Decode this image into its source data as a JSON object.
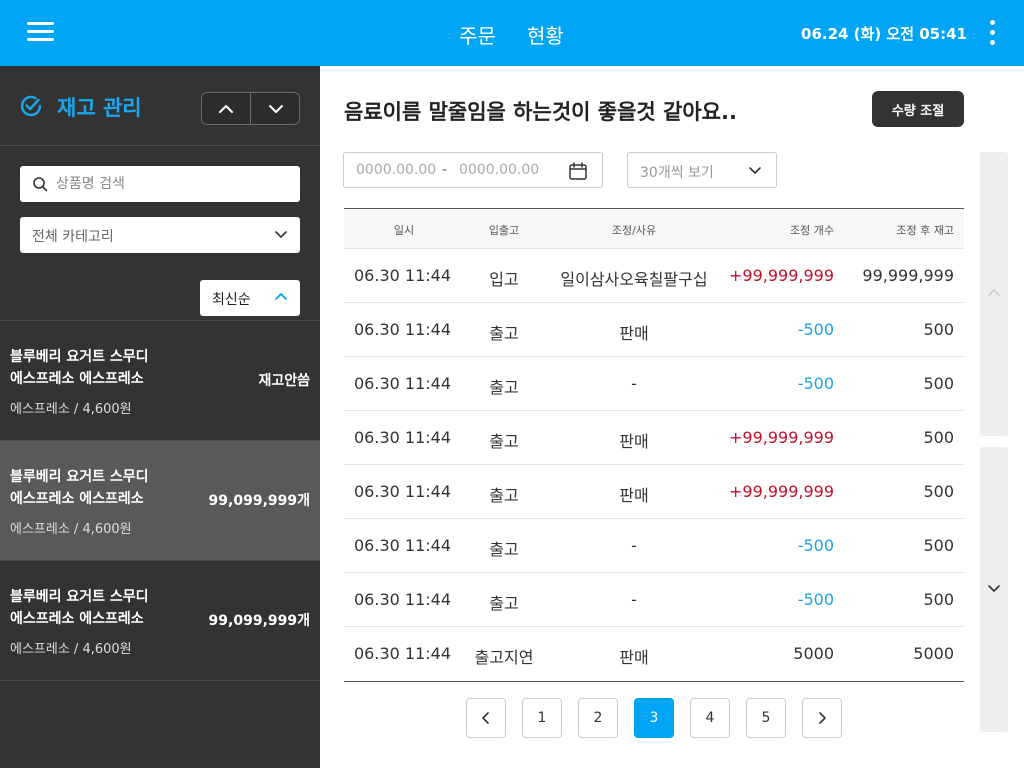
{
  "header": {
    "tabs": [
      "주문",
      "현황"
    ],
    "datetime": "06.24 (화) 오전 05:41"
  },
  "sidebar": {
    "title": "재고 관리",
    "search_placeholder": "상품명 검색",
    "category": "전체 카테고리",
    "sort": "최신순",
    "products": [
      {
        "name_line1": "블루베리 요거트 스무디",
        "name_line2": "에스프레소 에스프레소",
        "sub": "에스프레소 / 4,600원",
        "stock": "재고안씀",
        "selected": false
      },
      {
        "name_line1": "블루베리 요거트 스무디",
        "name_line2": "에스프레소 에스프레소",
        "sub": "에스프레소 / 4,600원",
        "stock": "99,099,999개",
        "selected": true
      },
      {
        "name_line1": "블루베리 요거트 스무디",
        "name_line2": "에스프레소 에스프레소",
        "sub": "에스프레소 / 4,600원",
        "stock": "99,099,999개",
        "selected": false
      }
    ]
  },
  "main": {
    "title": "음료이름 말줄임을 하는것이 좋을것 같아요..",
    "adjust_button": "수량 조절",
    "date_start": "0000.00.00",
    "date_sep": "-",
    "date_end": "0000.00.00",
    "per_page": "30개씩 보기",
    "table": {
      "headers": [
        "일시",
        "입출고",
        "조정/사유",
        "조정 개수",
        "조정 후 재고"
      ],
      "rows": [
        {
          "date": "06.30 11:44",
          "type": "입고",
          "reason": "일이삼사오육칠팔구십",
          "qty": "+99,999,999",
          "qty_kind": "pos",
          "after": "99,999,999"
        },
        {
          "date": "06.30 11:44",
          "type": "출고",
          "reason": "판매",
          "qty": "-500",
          "qty_kind": "neg",
          "after": "500"
        },
        {
          "date": "06.30 11:44",
          "type": "출고",
          "reason": "-",
          "qty": "-500",
          "qty_kind": "neg",
          "after": "500"
        },
        {
          "date": "06.30 11:44",
          "type": "출고",
          "reason": "판매",
          "qty": "+99,999,999",
          "qty_kind": "pos",
          "after": "500"
        },
        {
          "date": "06.30 11:44",
          "type": "출고",
          "reason": "판매",
          "qty": "+99,999,999",
          "qty_kind": "pos",
          "after": "500"
        },
        {
          "date": "06.30 11:44",
          "type": "출고",
          "reason": "-",
          "qty": "-500",
          "qty_kind": "neg",
          "after": "500"
        },
        {
          "date": "06.30 11:44",
          "type": "출고",
          "reason": "-",
          "qty": "-500",
          "qty_kind": "neg",
          "after": "500"
        },
        {
          "date": "06.30 11:44",
          "type": "출고지연",
          "reason": "판매",
          "qty": "5000",
          "qty_kind": "plain",
          "after": "5000"
        }
      ]
    },
    "pagination": {
      "pages": [
        "1",
        "2",
        "3",
        "4",
        "5"
      ],
      "current": "3"
    }
  },
  "colors": {
    "accent": "#00a5f5",
    "positive": "#c0122c",
    "negative": "#1aa6e6",
    "sidebar_bg": "#333333"
  }
}
